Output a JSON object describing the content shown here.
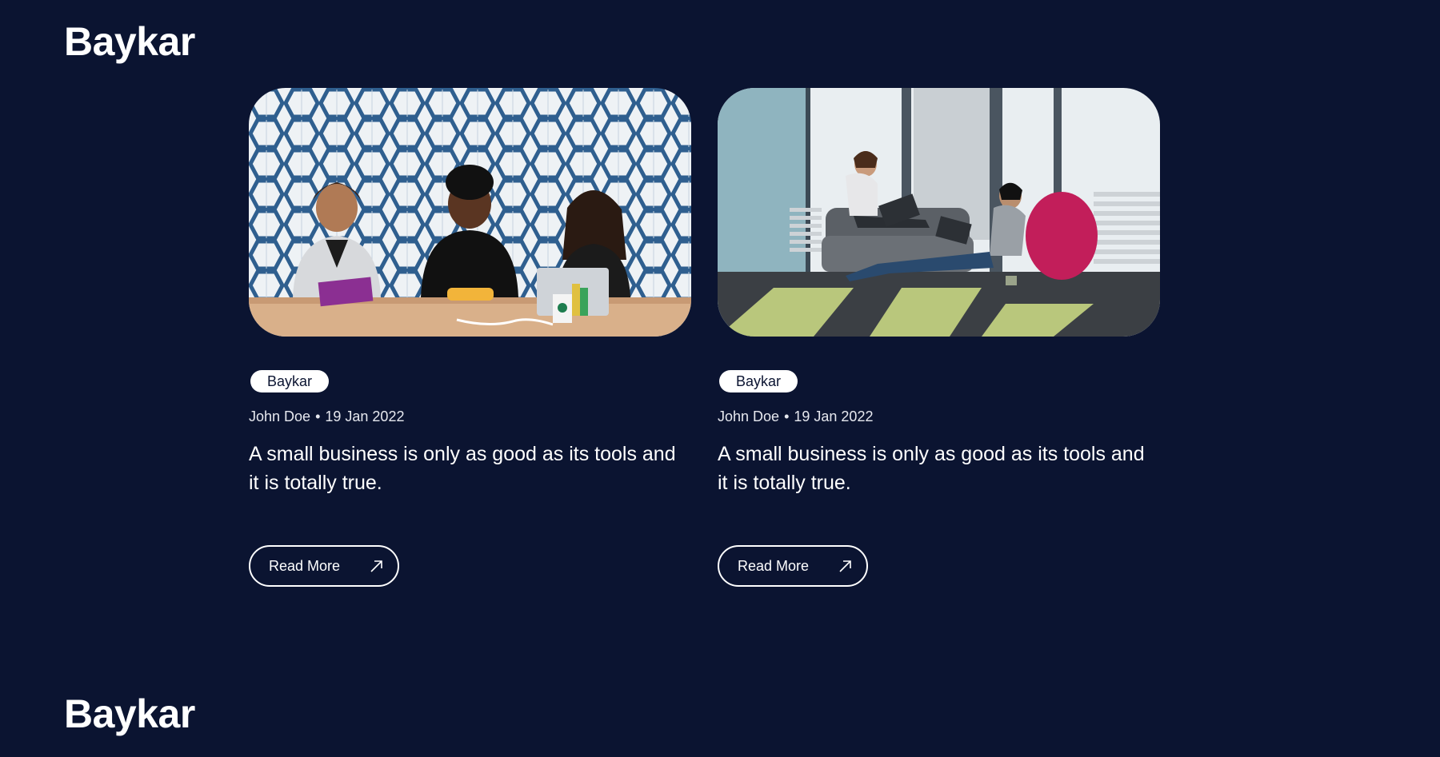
{
  "header": {
    "brand": "Baykar"
  },
  "cards": [
    {
      "tag": "Baykar",
      "author": "John Doe",
      "separator": "•",
      "date": "19 Jan 2022",
      "title": "A small business is only as good as its tools and it is totally true.",
      "read_more": "Read More",
      "image_icon": "arrow-up-right-icon"
    },
    {
      "tag": "Baykar",
      "author": "John Doe",
      "separator": "•",
      "date": "19 Jan 2022",
      "title": "A small business is only as good as its tools and it is totally true.",
      "read_more": "Read More",
      "image_icon": "arrow-up-right-icon"
    }
  ],
  "footer": {
    "brand": "Baykar"
  },
  "colors": {
    "background": "#0b1431",
    "text": "#ffffff",
    "tag_bg": "#ffffff"
  }
}
